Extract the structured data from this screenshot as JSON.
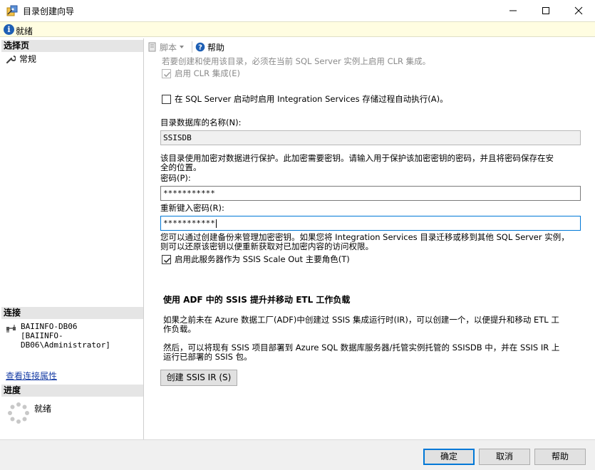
{
  "window": {
    "title": "目录创建向导"
  },
  "status": {
    "text": "就绪"
  },
  "left": {
    "select_page_label": "选择页",
    "nav_items": [
      {
        "label": "常规"
      }
    ],
    "connection_label": "连接",
    "server": "BAIINFO-DB06",
    "user": "[BAIINFO-DB06\\Administrator]",
    "view_conn_link": "查看连接属性",
    "progress_label": "进度",
    "progress_status": "就绪"
  },
  "toolbar": {
    "script_label": "脚本",
    "help_label": "帮助"
  },
  "form": {
    "clr_note": "若要创建和使用该目录，必须在当前 SQL Server 实例上启用 CLR 集成。",
    "enable_clr_label": "启用 CLR 集成(E)",
    "enable_clr_checked": true,
    "auto_exec_label": "在 SQL Server 启动时启用 Integration Services 存储过程自动执行(A)。",
    "auto_exec_checked": false,
    "db_name_label": "目录数据库的名称(N):",
    "db_name_value": "SSISDB",
    "encrypt_note_1": "该目录使用加密对数据进行保护。此加密需要密钥。请输入用于保护该加密密钥的密码，并且将密码保存在安",
    "encrypt_note_2": "全的位置。",
    "password_label": "密码(P):",
    "password_value": "***********",
    "retype_label": "重新键入密码(R):",
    "retype_value": "***********",
    "backup_note_1": "您可以通过创建备份来管理加密密钥。如果您将 Integration Services 目录迁移或移到其他 SQL Server 实例，",
    "backup_note_2": "则可以还原该密钥以便重新获取对已加密内容的访问权限。",
    "scaleout_label": "启用此服务器作为 SSIS Scale Out 主要角色(T)",
    "scaleout_checked": true,
    "adf_heading": "使用 ADF 中的 SSIS 提升并移动 ETL 工作负载",
    "adf_note_1": "如果之前未在 Azure 数据工厂(ADF)中创建过 SSIS 集成运行时(IR)，可以创建一个，以便提升和移动 ETL 工",
    "adf_note_2": "作负载。",
    "deploy_note_1": "然后，可以将现有 SSIS 项目部署到 Azure SQL 数据库服务器/托管实例托管的 SSISDB 中，并在 SSIS IR 上",
    "deploy_note_2": "运行已部署的 SSIS 包。",
    "create_ir_label": "创建 SSIS IR (S)"
  },
  "footer": {
    "ok_label": "确定",
    "cancel_label": "取消",
    "help_label": "帮助"
  }
}
